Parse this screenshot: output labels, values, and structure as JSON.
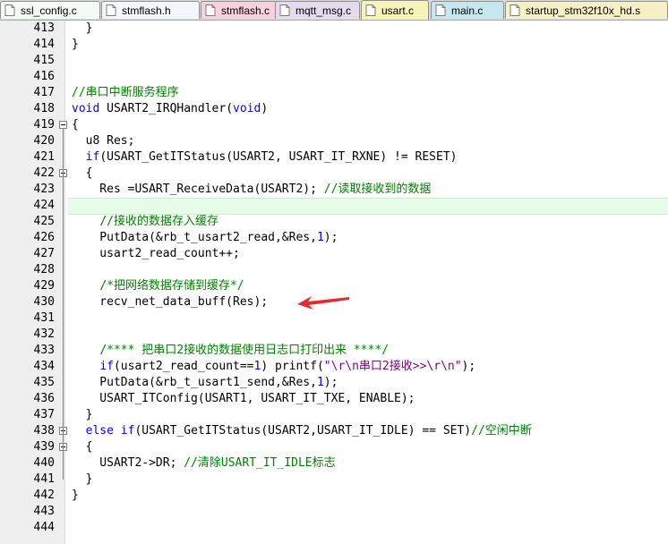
{
  "tabs": [
    {
      "label": "ssl_config.c",
      "color": "#f4fbf4"
    },
    {
      "label": "stmflash.h",
      "color": "#f3f6fb"
    },
    {
      "label": "stmflash.c",
      "color": "#f7d2de"
    },
    {
      "label": "mqtt_msg.c",
      "color": "#e5dbef"
    },
    {
      "label": "usart.c",
      "color": "#f6f4b8",
      "active": true
    },
    {
      "label": "main.c",
      "color": "#c4e8ed"
    },
    {
      "label": "startup_stm32f10x_hd.s",
      "color": "#f6f1c4"
    }
  ],
  "line_numbers": [
    "413",
    "414",
    "415",
    "416",
    "417",
    "418",
    "419",
    "420",
    "421",
    "422",
    "423",
    "424",
    "425",
    "426",
    "427",
    "428",
    "429",
    "430",
    "431",
    "432",
    "433",
    "434",
    "435",
    "436",
    "437",
    "438",
    "439",
    "440",
    "441",
    "442",
    "443",
    "444"
  ],
  "code_lines": [
    [
      "  }"
    ],
    [
      "}"
    ],
    [
      ""
    ],
    [
      ""
    ],
    [
      "//串口中断服务程序"
    ],
    [
      "void",
      " USART2_IRQHandler(",
      "void",
      ")"
    ],
    [
      "{"
    ],
    [
      "  u8 Res;"
    ],
    [
      "  ",
      "if",
      "(USART_GetITStatus(USART2, USART_IT_RXNE) != RESET)"
    ],
    [
      "  {"
    ],
    [
      "    Res =USART_ReceiveData(USART2); ",
      "//读取接收到的数据"
    ],
    [
      ""
    ],
    [
      "    ",
      "//接收的数据存入缓存"
    ],
    [
      "    PutData(&rb_t_usart2_read,&Res,",
      "1",
      ");"
    ],
    [
      "    usart2_read_count++;"
    ],
    [
      ""
    ],
    [
      "    ",
      "/*把网络数据存储到缓存*/"
    ],
    [
      "    recv_net_data_buff(Res);"
    ],
    [
      ""
    ],
    [
      ""
    ],
    [
      "    ",
      "/**** 把串口2接收的数据使用日志口打印出来 ****/"
    ],
    [
      "    ",
      "if",
      "(usart2_read_count==",
      "1",
      ") printf(",
      "\"\\r\\n串口2接收>>\\r\\n\"",
      ");"
    ],
    [
      "    PutData(&rb_t_usart1_send,&Res,",
      "1",
      ");"
    ],
    [
      "    USART_ITConfig(USART1, USART_IT_TXE, ENABLE);"
    ],
    [
      "  }"
    ],
    [
      "  ",
      "else",
      " ",
      "if",
      "(USART_GetITStatus(USART2,USART_IT_IDLE) == SET)",
      "//空闲中断"
    ],
    [
      "  {"
    ],
    [
      "    USART2->DR; ",
      "//清除USART_IT_IDLE标志"
    ],
    [
      "  }"
    ],
    [
      "}"
    ],
    [
      ""
    ],
    [
      ""
    ]
  ],
  "code_classes": [
    [
      ""
    ],
    [
      ""
    ],
    [
      ""
    ],
    [
      ""
    ],
    [
      "cm"
    ],
    [
      "kw",
      "",
      "kw",
      ""
    ],
    [
      ""
    ],
    [
      ""
    ],
    [
      "",
      "kw",
      ""
    ],
    [
      ""
    ],
    [
      "",
      "cm"
    ],
    [
      ""
    ],
    [
      "",
      "cm"
    ],
    [
      "",
      "kw",
      ""
    ],
    [
      ""
    ],
    [
      ""
    ],
    [
      "",
      "cm"
    ],
    [
      ""
    ],
    [
      ""
    ],
    [
      ""
    ],
    [
      "",
      "cm"
    ],
    [
      "",
      "kw",
      "",
      "kw",
      "",
      "st",
      ""
    ],
    [
      "",
      "kw",
      ""
    ],
    [
      ""
    ],
    [
      ""
    ],
    [
      "",
      "kw",
      "",
      "kw",
      "",
      "cm"
    ],
    [
      ""
    ],
    [
      "",
      "cm"
    ],
    [
      ""
    ],
    [
      ""
    ],
    [
      ""
    ],
    [
      ""
    ]
  ],
  "highlighted_line": "424",
  "annotation_icon": "red-arrow-icon"
}
